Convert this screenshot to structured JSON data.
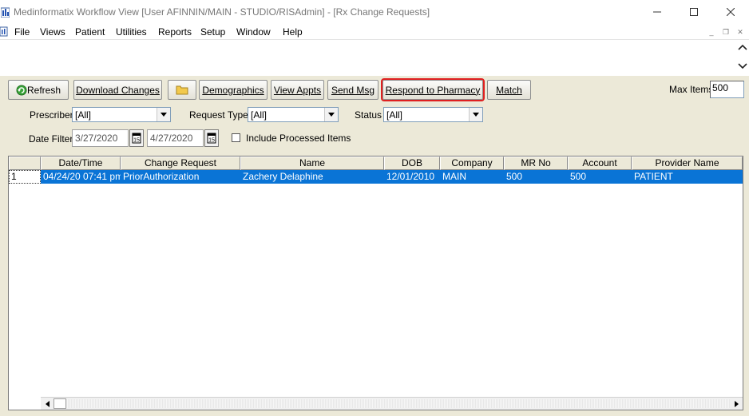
{
  "window": {
    "title": "Medinformatix Workflow View [User AFINNIN/MAIN - STUDIO/RISAdmin] - [Rx Change Requests]",
    "minimize_icon": "minimize-icon",
    "maximize_icon": "maximize-icon",
    "close_icon": "close-icon"
  },
  "menu": {
    "items": [
      "File",
      "Views",
      "Patient",
      "Utilities",
      "Reports",
      "Setup",
      "Window",
      "Help"
    ]
  },
  "toolbar": {
    "refresh": "Refresh",
    "download_changes": "Download Changes",
    "folder_icon": "folder-icon",
    "demographics": "Demographics",
    "view_appts": "View Appts",
    "send_msg": "Send Msg",
    "respond_to_pharmacy": "Respond to Pharmacy",
    "match": "Match",
    "max_items_label": "Max Items",
    "max_items_value": "500"
  },
  "filters": {
    "prescriber_label": "Prescriber",
    "prescriber_value": "[All]",
    "request_type_label": "Request Type",
    "request_type_value": "[All]",
    "status_label": "Status",
    "status_value": "[All]",
    "date_filter_label": "Date Filter",
    "date_from": "3/27/2020",
    "date_to": "4/27/2020",
    "include_processed_label": "Include Processed Items",
    "include_processed_checked": false
  },
  "grid": {
    "columns": [
      "Date/Time",
      "Change Request",
      "Name",
      "DOB",
      "Company",
      "MR No",
      "Account",
      "Provider Name"
    ],
    "rows": [
      {
        "index": "1",
        "cells": [
          "04/24/20 07:41 pm",
          "PriorAuthorization",
          "Zachery Delaphine",
          "12/01/2010",
          "MAIN",
          "500",
          "500",
          "PATIENT"
        ]
      }
    ],
    "selection_color": "#0a74d6"
  }
}
